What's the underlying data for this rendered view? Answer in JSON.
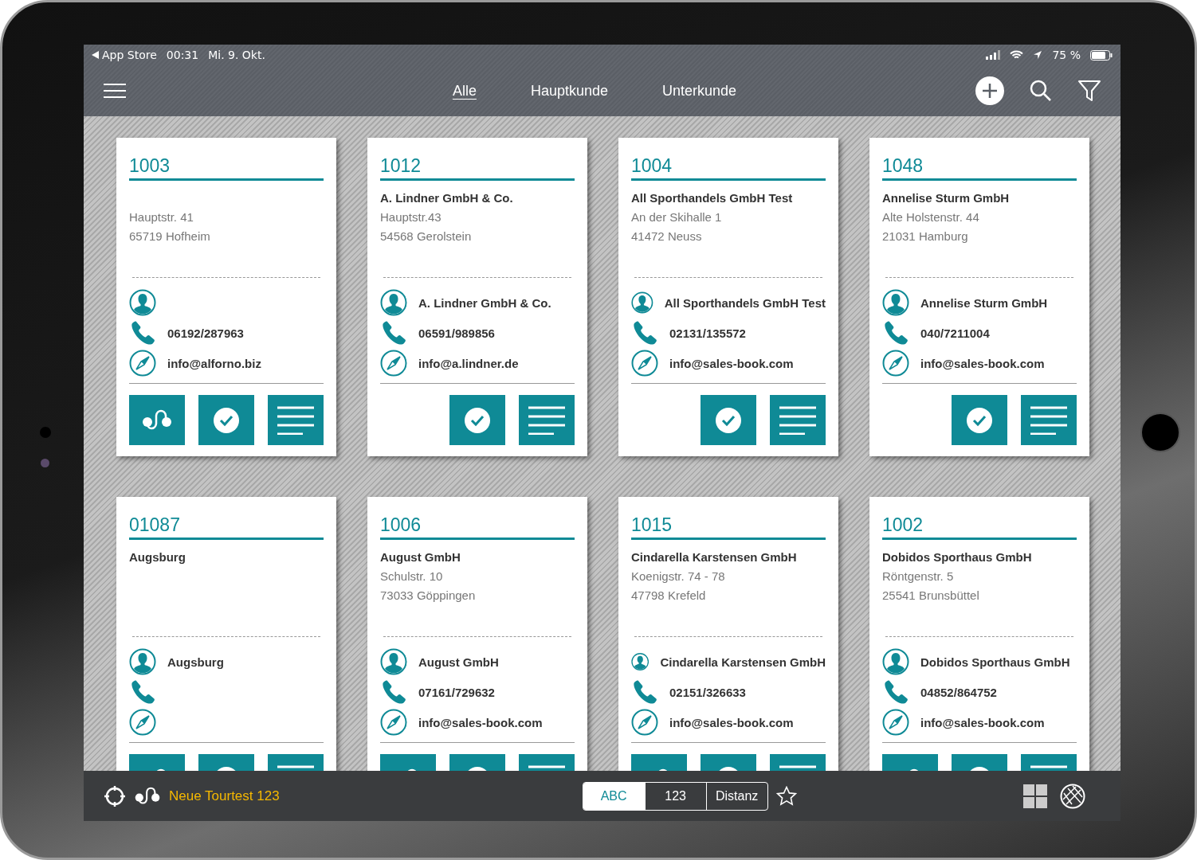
{
  "status_bar": {
    "back_label": "App Store",
    "time": "00:31",
    "date": "Mi. 9. Okt.",
    "battery": "75 %"
  },
  "tabs": [
    {
      "label": "Alle",
      "selected": true
    },
    {
      "label": "Hauptkunde",
      "selected": false
    },
    {
      "label": "Unterkunde",
      "selected": false
    }
  ],
  "cards": [
    {
      "number": "1003",
      "street": "Hauptstr. 41",
      "city": "65719 Hofheim",
      "phone": "06192/287963",
      "email": "info@alforno.biz",
      "route": true
    },
    {
      "number": "1012",
      "company": "A. Lindner GmbH & Co.",
      "street": "Hauptstr.43",
      "city": "54568 Gerolstein",
      "contact": "A. Lindner GmbH & Co.",
      "phone": "06591/989856",
      "email": "info@a.lindner.de",
      "route": false
    },
    {
      "number": "1004",
      "company": "All Sporthandels GmbH Test",
      "street": "An der Skihalle 1",
      "city": "41472 Neuss",
      "contact": "All Sporthandels GmbH Test",
      "phone": "02131/135572",
      "email": "info@sales-book.com",
      "route": false
    },
    {
      "number": "1048",
      "company": "Annelise Sturm GmbH",
      "street": "Alte Holstenstr. 44",
      "city": "21031 Hamburg",
      "contact": "Annelise Sturm GmbH",
      "phone": "040/7211004",
      "email": "info@sales-book.com",
      "route": false
    },
    {
      "number": "01087",
      "company": "Augsburg",
      "contact": "Augsburg",
      "route": true
    },
    {
      "number": "1006",
      "company": "August GmbH",
      "street": "Schulstr. 10",
      "city": "73033 Göppingen",
      "contact": "August GmbH",
      "phone": "07161/729632",
      "email": "info@sales-book.com",
      "route": true
    },
    {
      "number": "1015",
      "company": "Cindarella Karstensen GmbH",
      "street": "Koenigstr. 74 - 78",
      "city": "47798 Krefeld",
      "contact": "Cindarella Karstensen GmbH",
      "phone": "02151/326633",
      "email": "info@sales-book.com",
      "route": true
    },
    {
      "number": "1002",
      "company": "Dobidos Sporthaus GmbH",
      "street": "Röntgenstr. 5",
      "city": "25541 Brunsbüttel",
      "contact": "Dobidos Sporthaus GmbH",
      "phone": "04852/864752",
      "email": "info@sales-book.com",
      "route": true
    }
  ],
  "bottom_bar": {
    "tour_name": "Neue Tourtest 123",
    "sort": [
      {
        "label": "ABC",
        "selected": true
      },
      {
        "label": "123",
        "selected": false
      },
      {
        "label": "Distanz",
        "selected": false
      }
    ]
  }
}
